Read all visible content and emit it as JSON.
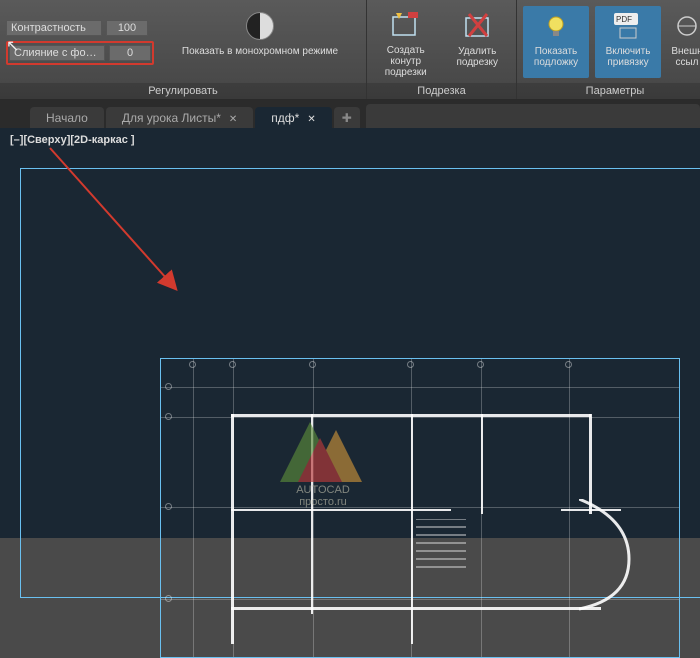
{
  "ribbon": {
    "group_regulate": {
      "title": "Регулировать",
      "contrast_label": "Контрастность",
      "contrast_value": "100",
      "fade_label": "Слияние с фон...",
      "fade_value": "0",
      "mono_label": "Показать в монохромном режиме"
    },
    "group_clip": {
      "title": "Подрезка",
      "create_clip": "Создать конутр подрезки",
      "remove_clip": "Удалить подрезку"
    },
    "group_params": {
      "title": "Параметры",
      "show_underlay": "Показать подложку",
      "enable_snap": "Включить привязку",
      "ext_links": "Внешн ссыл"
    }
  },
  "tabs": {
    "home": "Начало",
    "sheets": "Для урока Листы*",
    "pdf": "пдф*"
  },
  "view": {
    "label": "[–][Сверху][2D-каркас ]"
  },
  "watermark": {
    "line1": "AUTOCAD",
    "line2": "просто.ru"
  }
}
